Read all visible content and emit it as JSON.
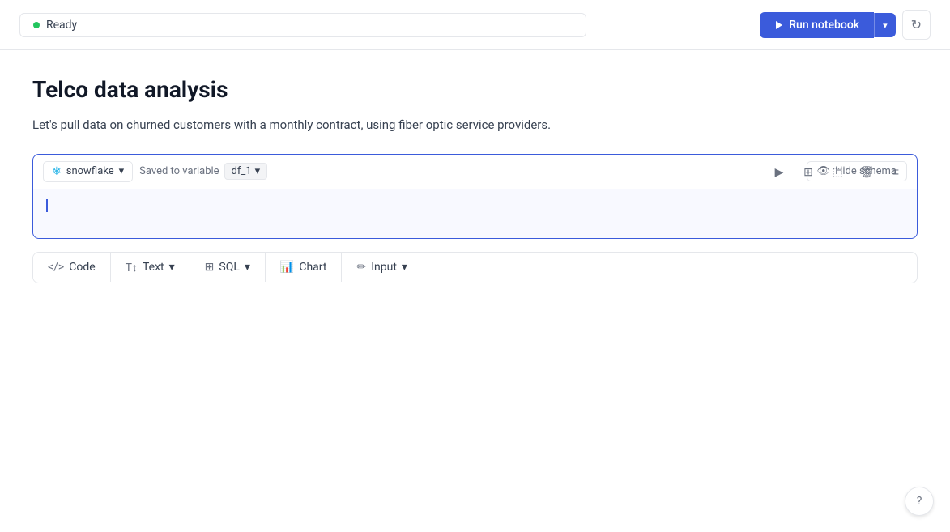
{
  "topbar": {
    "status_label": "Ready",
    "run_btn_label": "Run notebook",
    "refresh_icon": "↻"
  },
  "page": {
    "title": "Telco data analysis",
    "description_parts": [
      "Let's pull data on churned customers with a monthly contract, using ",
      "fiber",
      " optic service providers."
    ]
  },
  "cell": {
    "datasource": "snowflake",
    "save_to_variable_label": "Saved to variable",
    "variable_name": "df_1",
    "hide_schema_label": "Hide schema",
    "cursor_placeholder": ""
  },
  "cell_actions": {
    "play_icon": "▶",
    "grid_icon": "⊞",
    "calendar_icon": "📅",
    "trash_icon": "🗑",
    "menu_icon": "≡"
  },
  "add_cell_buttons": [
    {
      "id": "code",
      "icon": "</>",
      "label": "Code"
    },
    {
      "id": "text",
      "icon": "T↕",
      "label": "Text",
      "has_chevron": true
    },
    {
      "id": "sql",
      "icon": "⊞",
      "label": "SQL",
      "has_chevron": true
    },
    {
      "id": "chart",
      "icon": "📊",
      "label": "Chart"
    },
    {
      "id": "input",
      "icon": "✏",
      "label": "Input",
      "has_chevron": true
    }
  ],
  "help": {
    "icon": "?"
  }
}
